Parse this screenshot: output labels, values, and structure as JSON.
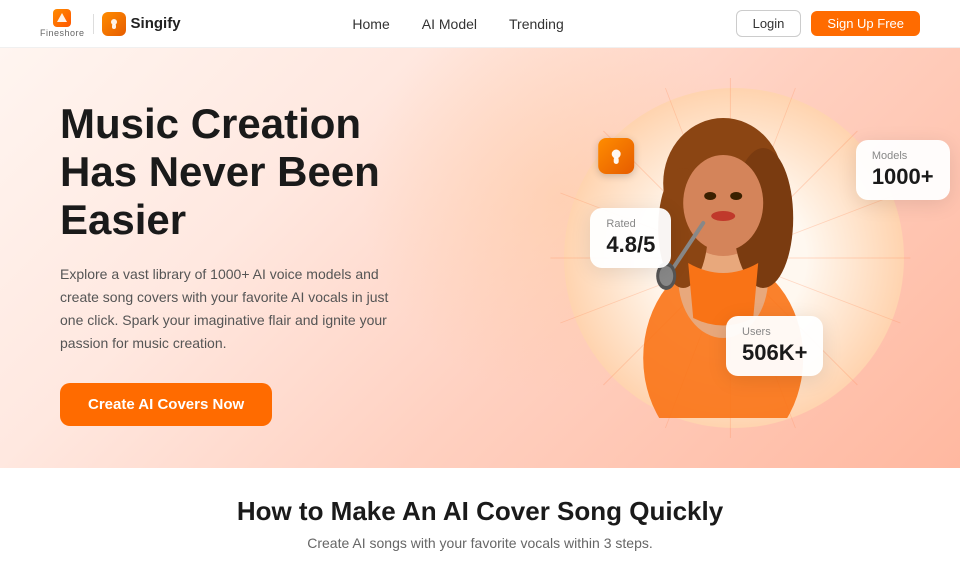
{
  "navbar": {
    "fineshare_label": "Fineshore",
    "singify_label": "Singify",
    "singify_icon": "♪",
    "nav_links": [
      "Home",
      "AI Model",
      "Trending"
    ],
    "login_label": "Login",
    "signup_label": "Sign Up Free"
  },
  "hero": {
    "title": "Music Creation Has Never Been Easier",
    "description": "Explore a vast library of 1000+ AI voice models and create song covers with your favorite AI vocals in just one click. Spark your imaginative flair and ignite your passion for music creation.",
    "cta_label": "Create AI Covers Now",
    "stats": {
      "rated_label": "Rated",
      "rated_value": "4.8/5",
      "models_label": "Models",
      "models_value": "1000+",
      "users_label": "Users",
      "users_value": "506K+"
    }
  },
  "bottom": {
    "title": "How to Make An AI Cover Song Quickly",
    "subtitle": "Create AI songs with your favorite vocals within 3 steps."
  }
}
